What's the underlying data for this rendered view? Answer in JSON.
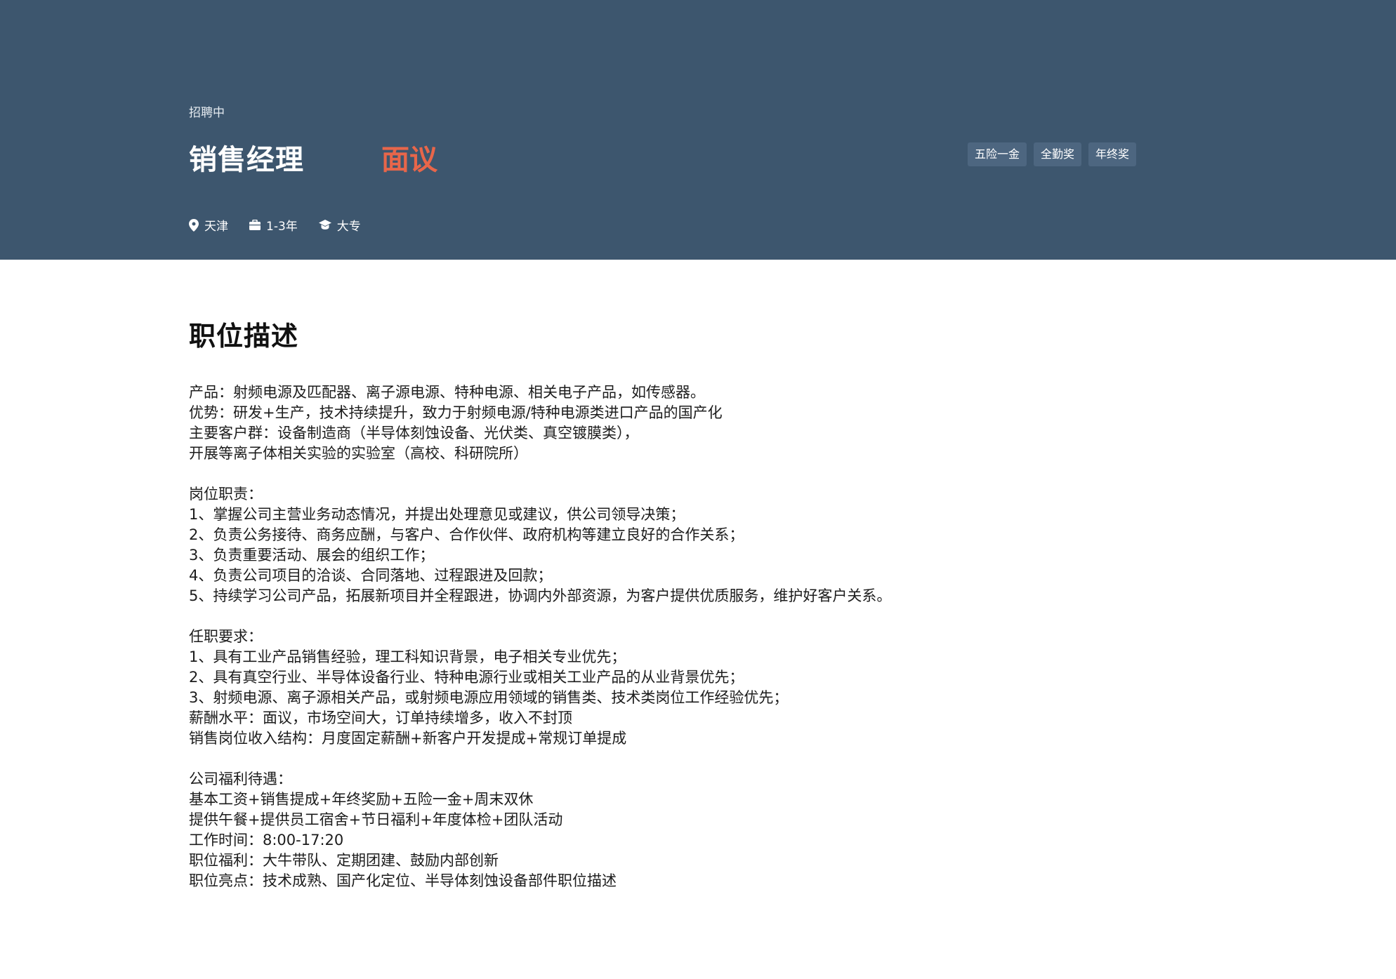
{
  "header": {
    "status": "招聘中",
    "job_title": "销售经理",
    "salary": "面议",
    "tags": [
      "五险一金",
      "全勤奖",
      "年终奖"
    ],
    "meta": {
      "location": "天津",
      "experience": "1-3年",
      "education": "大专"
    }
  },
  "main": {
    "section_title": "职位描述",
    "lines": [
      "产品：射频电源及匹配器、离子源电源、特种电源、相关电子产品，如传感器。",
      "优势：研发+生产，技术持续提升，致力于射频电源/特种电源类进口产品的国产化",
      "主要客户群：设备制造商（半导体刻蚀设备、光伏类、真空镀膜类），",
      "开展等离子体相关实验的实验室（高校、科研院所）",
      "",
      "岗位职责：",
      "1、掌握公司主营业务动态情况，并提出处理意见或建议，供公司领导决策；",
      "2、负责公务接待、商务应酬，与客户、合作伙伴、政府机构等建立良好的合作关系；",
      "3、负责重要活动、展会的组织工作；",
      "4、负责公司项目的洽谈、合同落地、过程跟进及回款；",
      "5、持续学习公司产品，拓展新项目并全程跟进，协调内外部资源，为客户提供优质服务，维护好客户关系。",
      "",
      "任职要求：",
      "1、具有工业产品销售经验，理工科知识背景，电子相关专业优先；",
      "2、具有真空行业、半导体设备行业、特种电源行业或相关工业产品的从业背景优先；",
      "3、射频电源、离子源相关产品，或射频电源应用领域的销售类、技术类岗位工作经验优先；",
      "薪酬水平：面议，市场空间大，订单持续增多，收入不封顶",
      "销售岗位收入结构：月度固定薪酬+新客户开发提成+常规订单提成",
      "",
      "公司福利待遇：",
      "基本工资+销售提成+年终奖励+五险一金+周末双休",
      "提供午餐+提供员工宿舍+节日福利+年度体检+团队活动",
      "工作时间：8:00-17:20",
      "职位福利：大牛带队、定期团建、鼓励内部创新",
      "职位亮点：技术成熟、国产化定位、半导体刻蚀设备部件职位描述"
    ]
  }
}
